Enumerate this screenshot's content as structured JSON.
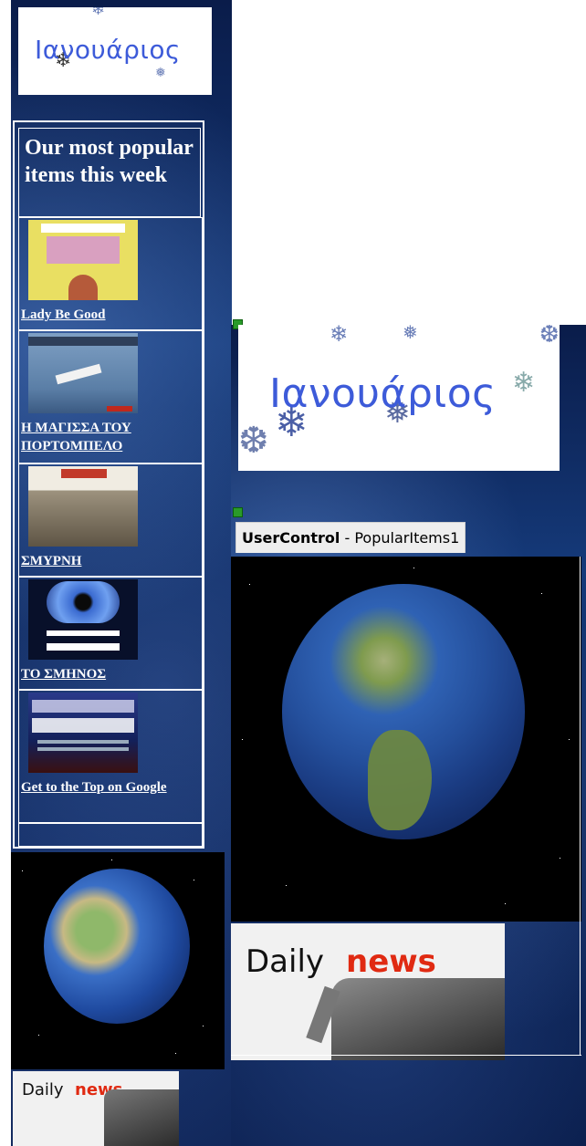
{
  "left": {
    "logo": {
      "text": "Ιανουάριος"
    },
    "popular": {
      "heading": "Our most popular items this week",
      "items": [
        {
          "title": "Lady Be Good",
          "cover_color": "#e8e16a"
        },
        {
          "title": "Η ΜΑΓΙΣΣΑ ΤΟΥ ΠΟΡΤΟΜΠΕΛΟ",
          "cover_color": "#6f90b6"
        },
        {
          "title": "ΣΜΥΡΝΗ",
          "cover_color": "#d9cfb8"
        },
        {
          "title": "ΤΟ ΣΜΗΝΟΣ",
          "cover_color": "#0b1330"
        },
        {
          "title": "Get to the Top on Google",
          "cover_color": "#1a2a6a"
        }
      ]
    },
    "daily": {
      "word1": "Daily",
      "word2": "news"
    }
  },
  "right": {
    "logo": {
      "text": "Ιανουάριος"
    },
    "usercontrol": {
      "bold": "UserControl",
      "rest": " - PopularItems1"
    },
    "daily": {
      "word1": "Daily",
      "word2": "news"
    }
  },
  "colors": {
    "space_dark": "#0a1c4a",
    "logo_blue": "#3d5bd9",
    "news_red": "#e02a12",
    "tag_green": "#2a9a2a"
  }
}
